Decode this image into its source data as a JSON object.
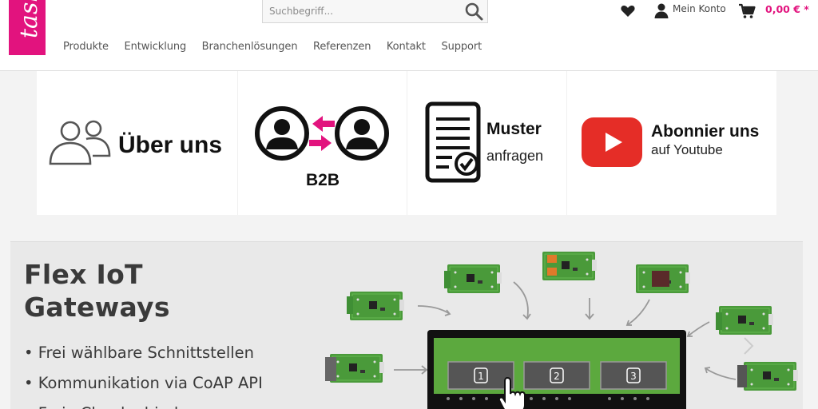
{
  "header": {
    "logo_text": "task",
    "search": {
      "placeholder": "Suchbegriff..."
    },
    "nav": [
      "Produkte",
      "Entwicklung",
      "Branchenlösungen",
      "Referenzen",
      "Kontakt",
      "Support"
    ],
    "account_label": "Mein Konto",
    "cart_amount": "0,00 € *"
  },
  "teasers": {
    "about": "Über uns",
    "b2b": "B2B",
    "muster_title": "Muster",
    "muster_sub": "anfragen",
    "youtube_title": "Abonnier uns",
    "youtube_sub": "auf Youtube"
  },
  "banner": {
    "title_line1": "Flex IoT",
    "title_line2": "Gateways",
    "bullets": [
      "• Frei wählbare Schnittstellen",
      "• Kommunikation via CoAP API",
      "• Freie Cloudanbindung"
    ],
    "slots": [
      "1",
      "2",
      "3"
    ]
  },
  "colors": {
    "brand": "#e2137e",
    "pcb": "#4a9a3a",
    "youtube": "#e52d27"
  }
}
